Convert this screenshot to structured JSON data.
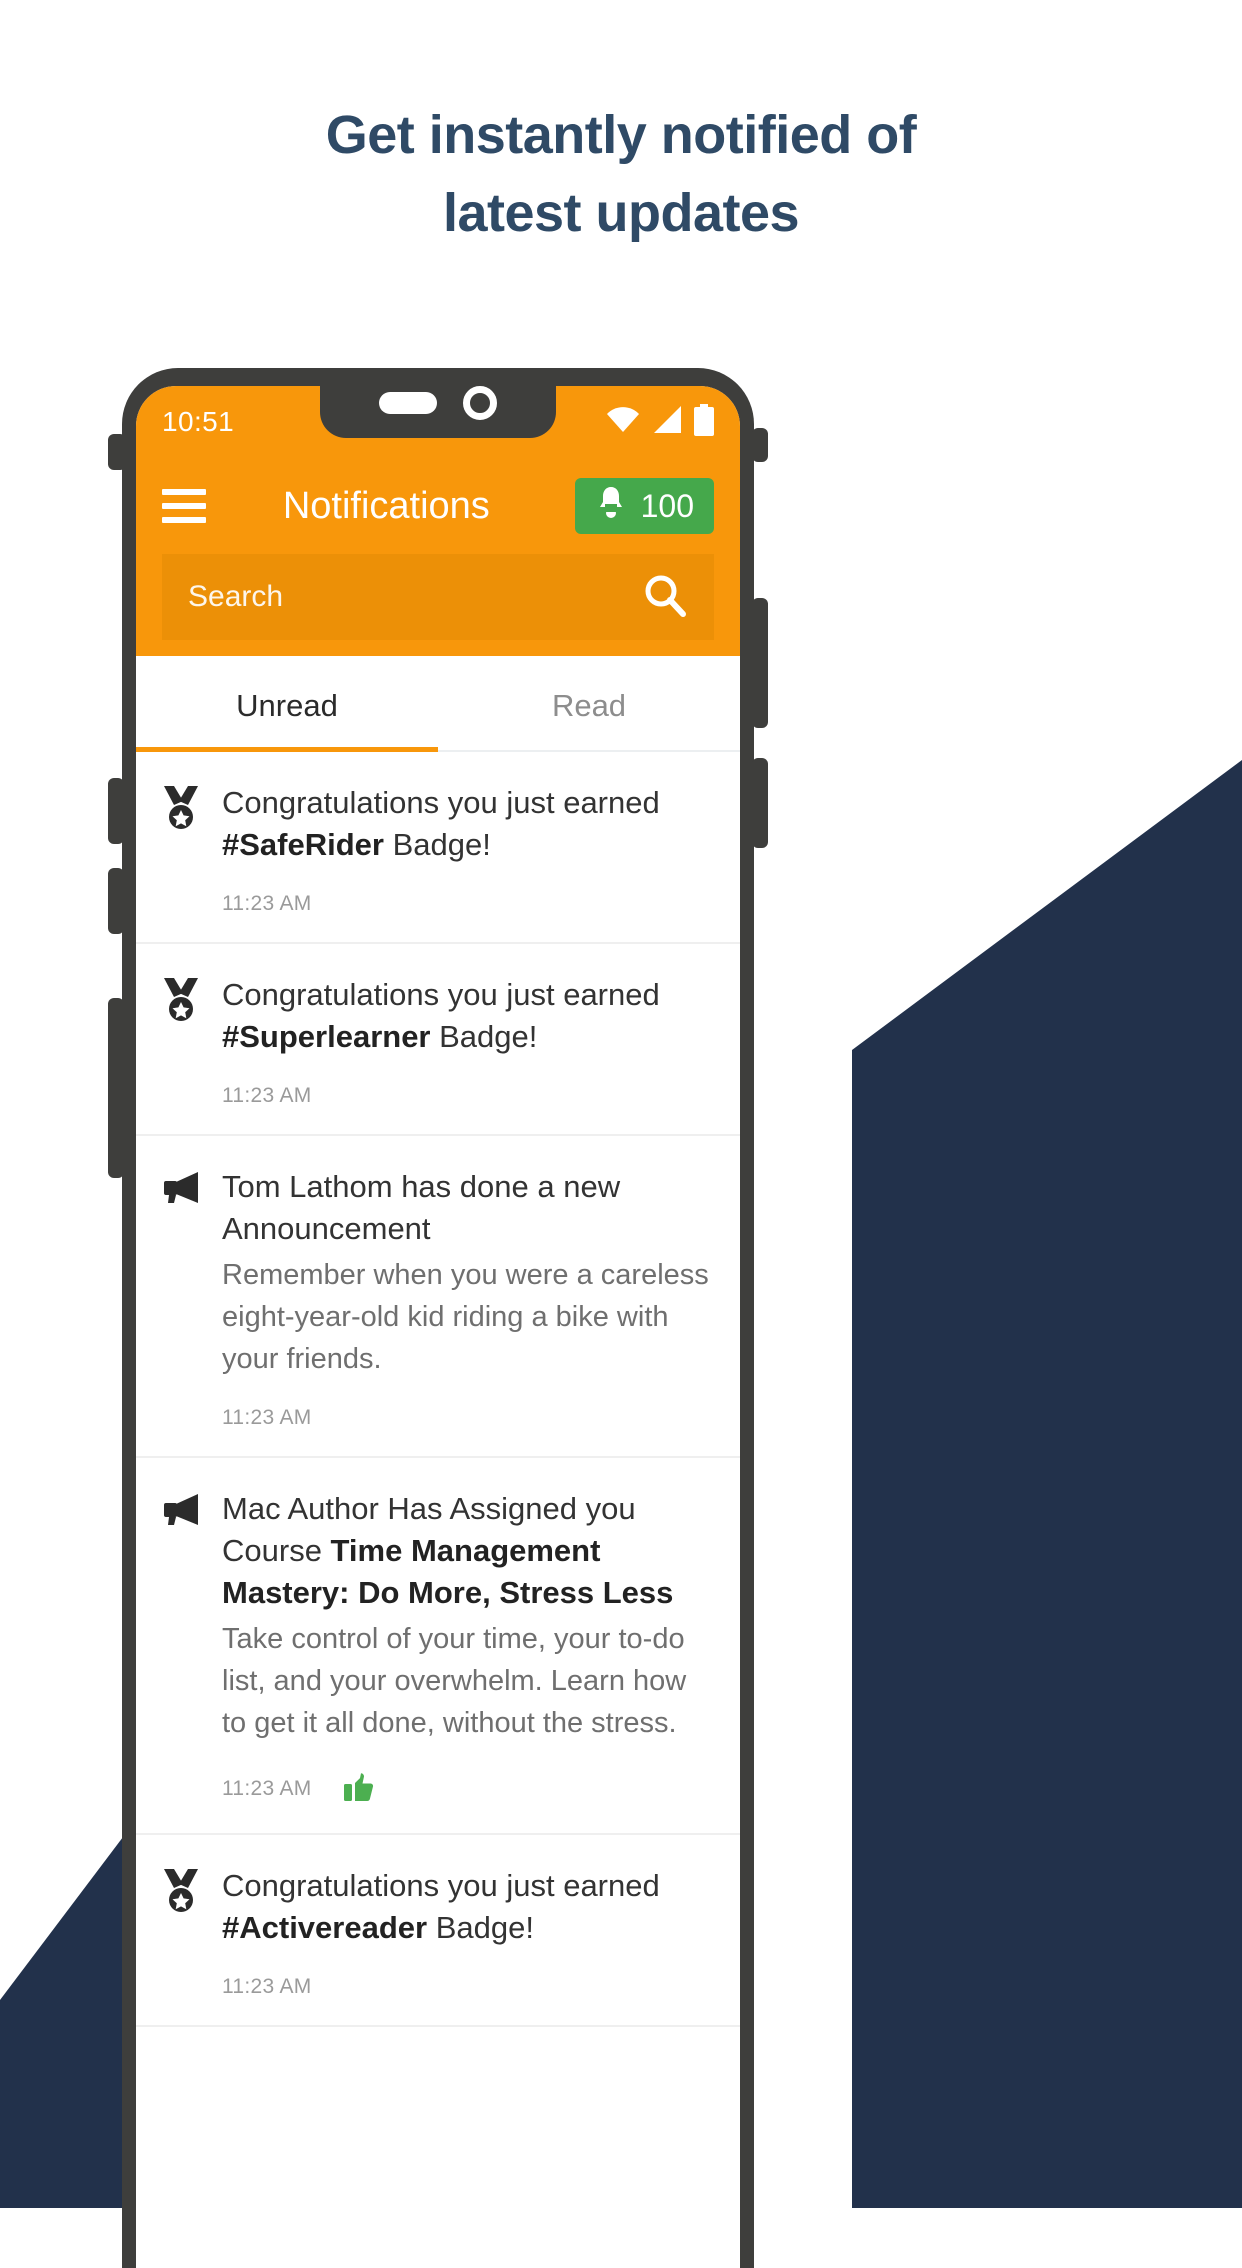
{
  "headline": {
    "line1": "Get instantly notified of",
    "line2": "latest updates",
    "color": "#2f4a66"
  },
  "colors": {
    "primary": "#F8970B",
    "search_field": "#EC9007",
    "badge_green": "#45A84B",
    "navy": "#22314B",
    "phone_frame": "#3e3e3c",
    "thumb_green": "#4CAF50"
  },
  "phone": {
    "statusbar": {
      "clock": "10:51",
      "icons": [
        "wifi-icon",
        "signal-icon",
        "battery-icon"
      ]
    },
    "appbar": {
      "menu_icon": "hamburger-menu-icon",
      "title": "Notifications",
      "badge": {
        "icon": "bell-icon",
        "count": "100"
      }
    },
    "search": {
      "placeholder": "Search",
      "value": "",
      "icon": "search-icon"
    },
    "tabs": [
      {
        "label": "Unread",
        "active": true
      },
      {
        "label": "Read",
        "active": false
      }
    ],
    "notifications": [
      {
        "icon": "medal-icon",
        "title_prefix": "Congratulations you just earned ",
        "title_bold": "#SafeRider",
        "title_suffix": " Badge!",
        "body": "",
        "time": "11:23 AM",
        "reaction": ""
      },
      {
        "icon": "medal-icon",
        "title_prefix": "Congratulations you just earned ",
        "title_bold": "#Superlearner",
        "title_suffix": " Badge!",
        "body": "",
        "time": "11:23 AM",
        "reaction": ""
      },
      {
        "icon": "megaphone-icon",
        "title_prefix": "Tom Lathom has done a new Announcement",
        "title_bold": "",
        "title_suffix": "",
        "body": "Remember when you were a careless eight-year-old kid riding a bike with your friends.",
        "time": "11:23 AM",
        "reaction": ""
      },
      {
        "icon": "megaphone-icon",
        "title_prefix": "Mac Author Has Assigned you Course ",
        "title_bold": "Time Management Mastery: Do More, Stress Less",
        "title_suffix": "",
        "body": "Take control of your time, your to-do list, and your overwhelm. Learn how to get it all done, without the stress.",
        "time": "11:23 AM",
        "reaction": "thumbs-up-icon"
      },
      {
        "icon": "medal-icon",
        "title_prefix": "Congratulations you just earned ",
        "title_bold": "#Activereader",
        "title_suffix": " Badge!",
        "body": "",
        "time": "11:23 AM",
        "reaction": ""
      }
    ]
  }
}
